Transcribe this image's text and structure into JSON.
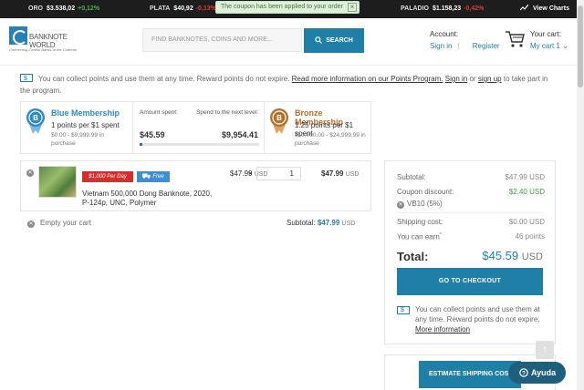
{
  "ticker": {
    "items": [
      {
        "name": "ORO",
        "price": "$3.538,02",
        "change": "+0,12%",
        "dir": "up"
      },
      {
        "name": "PLATA",
        "price": "$40,92",
        "change": "-0,13%",
        "dir": "down"
      },
      {
        "name": "PALADIO",
        "price": "$1.158,23",
        "change": "-0,42%",
        "dir": "down"
      }
    ],
    "notice": "The coupon has been applied to your order",
    "notice_close": "×",
    "view_charts": "View Charts"
  },
  "header": {
    "logo_text": "BANKNOTE WORLD",
    "logo_tagline": "Connecting Central Banks to the Collector",
    "search_placeholder": "FIND BANKNOTES, COINS AND MORE...",
    "search_button": "SEARCH",
    "account_label": "Account:",
    "sign_in": "Sign in",
    "separator": "|",
    "register": "Register",
    "cart_label": "Your cart:",
    "cart_count": "My cart 1 ⌄"
  },
  "points_info": {
    "text1": "You can collect points and use them at any time. Reward points do not expire.",
    "link_more": "Read more information on our Points Program.",
    "link_signin": "Sign in",
    "or": "or",
    "link_signup": "sign up",
    "text2": "to take part in the program."
  },
  "membership": {
    "blue": {
      "title": "Blue Membership",
      "rate": "1 points per $1 spent",
      "range": "$0.00 - $9,999.99 in purchase"
    },
    "amount_label": "Amount spent:",
    "amount_value": "$45.59",
    "next_label": "Spend to the next level:",
    "next_value": "$9,954.41",
    "progress": 0.005,
    "bronze": {
      "title": "Bronze Membership",
      "rate": "1.25 points per $1 spent",
      "range": "$10,000.00 - $24,999.99 in purchase"
    }
  },
  "cart_item": {
    "tag_daily": "$1,000 Per Day",
    "tag_free": "Free",
    "title": "Vietnam 500,000 Dong Banknote, 2020, P-124p, UNC, Polymer",
    "unit_price": "$47.99",
    "currency": "USD",
    "times": "×",
    "quantity": "1",
    "line_total": "$47.99"
  },
  "cart_footer": {
    "empty_cart": "Empty your cart",
    "subtotal_label": "Subtotal:",
    "subtotal_value": "$47.99",
    "currency": "USD"
  },
  "summary": {
    "subtotal_label": "Subtotal:",
    "subtotal_value": "$47.99 USD",
    "coupon_label": "Coupon discount:",
    "coupon_value": "$2.40 USD",
    "coupon_code": "VB10 (5%)",
    "shipping_label": "Shipping cost:",
    "shipping_value": "$0.00 USD",
    "earn_label": "You can earn",
    "earn_mark": "*",
    "earn_value": "46 points",
    "total_label": "Total:",
    "total_value": "$45.59",
    "total_currency": "USD",
    "checkout_button": "GO TO CHECKOUT",
    "points_text": "You can collect points and use them at any time. Reward points do not expire.",
    "points_link": "More information"
  },
  "shipping_button": "ESTIMATE SHIPPING COS",
  "help_button": "Ayuda",
  "to_top": "↑",
  "colors": {
    "accent": "#1f7fa6",
    "positive": "#4caf50",
    "negative": "#e53935",
    "bronze": "#b37028",
    "blue_member": "#2a8cc4"
  }
}
